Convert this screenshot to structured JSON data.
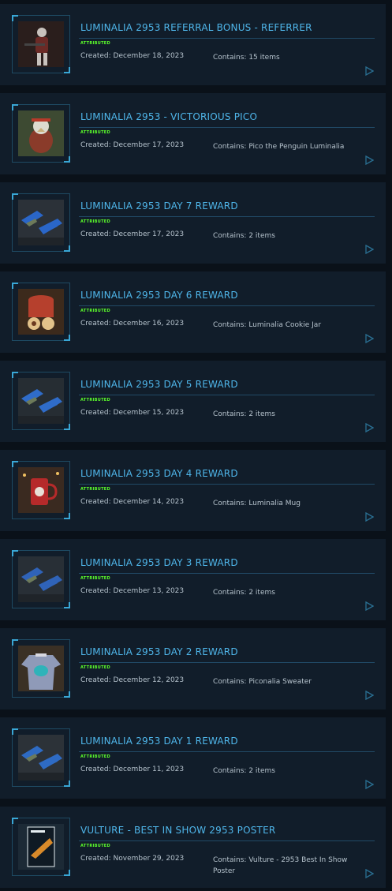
{
  "items": [
    {
      "title": "LUMINALIA 2953 REFERRAL BONUS - REFERRER",
      "status": "ATTRIBUTED",
      "created": "Created: December 18, 2023",
      "contains": "Contains: 15 items",
      "thumb": "armored-character",
      "colors": [
        "#2a1e1c",
        "#6b2a26",
        "#c8c2bd"
      ]
    },
    {
      "title": "LUMINALIA 2953 - VICTORIOUS PICO",
      "status": "ATTRIBUTED",
      "created": "Created: December 17, 2023",
      "contains": "Contains: Pico the Penguin Luminalia",
      "thumb": "penguin-plush",
      "colors": [
        "#3d4a32",
        "#8a3b2a",
        "#c9b07a"
      ]
    },
    {
      "title": "LUMINALIA 2953 DAY 7 REWARD",
      "status": "ATTRIBUTED",
      "created": "Created: December 17, 2023",
      "contains": "Contains: 2 items",
      "thumb": "ships",
      "colors": [
        "#2b3138",
        "#c8d0c4",
        "#2a66c8"
      ]
    },
    {
      "title": "LUMINALIA 2953 DAY 6 REWARD",
      "status": "ATTRIBUTED",
      "created": "Created: December 16, 2023",
      "contains": "Contains: Luminalia Cookie Jar",
      "thumb": "cookie-jar",
      "colors": [
        "#3c2a1c",
        "#b6402d",
        "#e2c28a"
      ]
    },
    {
      "title": "LUMINALIA 2953 DAY 5 REWARD",
      "status": "ATTRIBUTED",
      "created": "Created: December 15, 2023",
      "contains": "Contains: 2 items",
      "thumb": "ships",
      "colors": [
        "#262d33",
        "#b9c4b4",
        "#2f6cc9"
      ]
    },
    {
      "title": "LUMINALIA 2953 DAY 4 REWARD",
      "status": "ATTRIBUTED",
      "created": "Created: December 14, 2023",
      "contains": "Contains: Luminalia Mug",
      "thumb": "mug",
      "colors": [
        "#3a2a20",
        "#b62a2a",
        "#e8e0d6"
      ]
    },
    {
      "title": "LUMINALIA 2953 DAY 3 REWARD",
      "status": "ATTRIBUTED",
      "created": "Created: December 13, 2023",
      "contains": "Contains: 2 items",
      "thumb": "ships",
      "colors": [
        "#282f36",
        "#d2d6d8",
        "#2f63b8"
      ]
    },
    {
      "title": "LUMINALIA 2953 DAY 2 REWARD",
      "status": "ATTRIBUTED",
      "created": "Created: December 12, 2023",
      "contains": "Contains: Piconalia Sweater",
      "thumb": "sweater",
      "colors": [
        "#3a3025",
        "#8f9ab8",
        "#2fb3b9"
      ]
    },
    {
      "title": "LUMINALIA 2953 DAY 1 REWARD",
      "status": "ATTRIBUTED",
      "created": "Created: December 11, 2023",
      "contains": "Contains: 2 items",
      "thumb": "ships",
      "colors": [
        "#2c3238",
        "#c8cfc4",
        "#2e6bc4"
      ]
    },
    {
      "title": "VULTURE - BEST IN SHOW 2953 POSTER",
      "status": "ATTRIBUTED",
      "created": "Created: November 29, 2023",
      "contains": "Contains: Vulture - 2953 Best In Show Poster",
      "thumb": "poster",
      "colors": [
        "#1c2a36",
        "#d88a2a",
        "#e6eef2"
      ]
    }
  ],
  "accent_color": "#4fb6ea",
  "status_color": "#5cff2b",
  "action_icon": "play-triangle-icon"
}
